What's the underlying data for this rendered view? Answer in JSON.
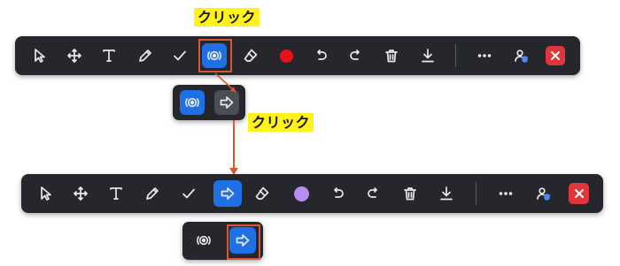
{
  "annotations": {
    "click_label_1": "クリック",
    "click_label_2": "クリック"
  },
  "toolbar_1": {
    "tools": [
      "pointer-icon",
      "move-icon",
      "text-icon",
      "pen-icon",
      "check-icon",
      "broadcast-icon",
      "eraser-icon",
      "color-swatch",
      "undo-icon",
      "redo-icon",
      "trash-icon",
      "download-icon",
      "more-icon",
      "user-shield-icon",
      "close-icon"
    ],
    "active_tool": "broadcast-icon",
    "color": "#e5141c",
    "accent": "#1f6fe5",
    "close_color": "#e0353a"
  },
  "popover_1": {
    "items": [
      "broadcast-icon",
      "arrow-right-icon"
    ],
    "selected": "broadcast-icon"
  },
  "toolbar_2": {
    "tools": [
      "pointer-icon",
      "move-icon",
      "text-icon",
      "pen-icon",
      "check-icon",
      "arrow-right-icon",
      "eraser-icon",
      "color-swatch",
      "undo-icon",
      "redo-icon",
      "trash-icon",
      "download-icon",
      "more-icon",
      "user-shield-icon",
      "close-icon"
    ],
    "active_tool": "arrow-right-icon",
    "color": "#b58ef0",
    "accent": "#1f6fe5",
    "close_color": "#e0353a"
  },
  "popover_2": {
    "items": [
      "broadcast-icon",
      "arrow-right-icon"
    ],
    "selected": "arrow-right-icon"
  }
}
